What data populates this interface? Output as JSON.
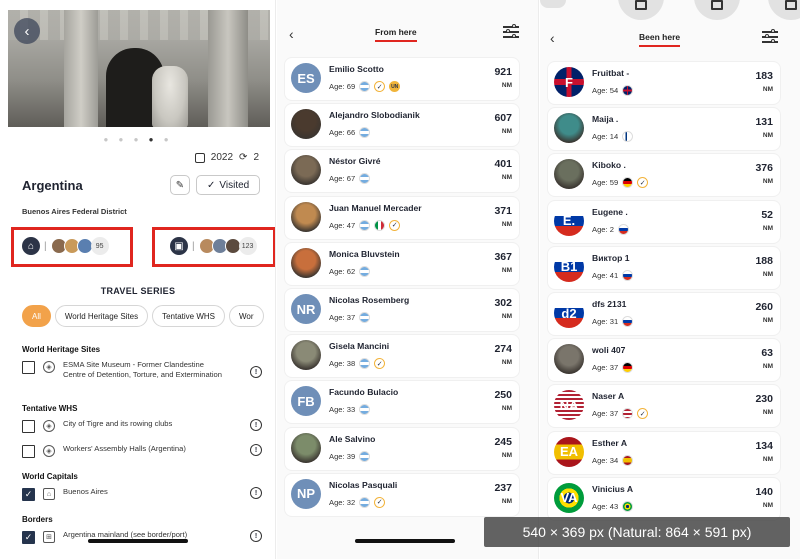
{
  "left": {
    "country": "Argentina",
    "region": "Buenos Aires Federal District",
    "year": "2022",
    "visits": "2",
    "visited_label": "Visited",
    "home_count": "95",
    "work_count": "123",
    "travel_series_title": "TRAVEL SERIES",
    "pills": [
      "All",
      "World Heritage Sites",
      "Tentative WHS",
      "Wor"
    ],
    "sections": [
      {
        "title": "World Heritage Sites",
        "items": [
          {
            "name": "ESMA Site Museum - Former Clandestine Centre of Detention, Torture, and Extermination",
            "checked": false
          }
        ]
      },
      {
        "title": "Tentative WHS",
        "items": [
          {
            "name": "City of Tigre and its rowing clubs",
            "checked": false
          },
          {
            "name": "Workers' Assembly Halls (Argentina)",
            "checked": false
          }
        ]
      },
      {
        "title": "World Capitals",
        "items": [
          {
            "name": "Buenos Aires",
            "checked": true
          }
        ]
      },
      {
        "title": "Borders",
        "items": [
          {
            "name": "Argentina mainland (see border/port)",
            "checked": true
          }
        ]
      }
    ]
  },
  "mid": {
    "tab": "From here",
    "rows": [
      {
        "name": "Emilio Scotto",
        "age": "Age: 69",
        "nm": "921",
        "initials": "ES",
        "color": "#6f8fb8",
        "badges": [
          "check",
          "un"
        ]
      },
      {
        "name": "Alejandro Slobodianik",
        "age": "Age: 66",
        "nm": "607",
        "initials": "",
        "color": "#4a3a2e",
        "badges": []
      },
      {
        "name": "Néstor Givré",
        "age": "Age: 67",
        "nm": "401",
        "initials": "",
        "color": "#7b6a55",
        "badges": []
      },
      {
        "name": "Juan Manuel Mercader",
        "age": "Age: 47",
        "nm": "371",
        "initials": "",
        "color": "#c08a50",
        "badges": [
          "italy",
          "check"
        ]
      },
      {
        "name": "Monica Bluvstein",
        "age": "Age: 62",
        "nm": "367",
        "initials": "",
        "color": "#c86f3c",
        "badges": []
      },
      {
        "name": "Nicolas Rosemberg",
        "age": "Age: 37",
        "nm": "302",
        "initials": "NR",
        "color": "#6f8fb8",
        "badges": []
      },
      {
        "name": "Gisela Mancini",
        "age": "Age: 38",
        "nm": "274",
        "initials": "",
        "color": "#8a8a76",
        "badges": [
          "check"
        ]
      },
      {
        "name": "Facundo Bulacio",
        "age": "Age: 33",
        "nm": "250",
        "initials": "FB",
        "color": "#6f8fb8",
        "badges": []
      },
      {
        "name": "Ale Salvino",
        "age": "Age: 39",
        "nm": "245",
        "initials": "",
        "color": "#7c8c6a",
        "badges": []
      },
      {
        "name": "Nicolas Pasquali",
        "age": "Age: 32",
        "nm": "237",
        "initials": "NP",
        "color": "#6f8fb8",
        "badges": [
          "check"
        ]
      }
    ],
    "unit": "NM"
  },
  "right": {
    "tab": "Been here",
    "rows": [
      {
        "name": "Fruitbat -",
        "age": "Age: 54",
        "nm": "183",
        "initials": "F",
        "color": "#c8102e",
        "flag": "uk",
        "badges": []
      },
      {
        "name": "Maija .",
        "age": "Age: 14",
        "nm": "131",
        "initials": "",
        "color": "#3f8c8a",
        "flag": "fi",
        "badges": []
      },
      {
        "name": "Kiboko .",
        "age": "Age: 59",
        "nm": "376",
        "initials": "",
        "color": "#6a6f5e",
        "flag": "de",
        "badges": [
          "check"
        ]
      },
      {
        "name": "Eugene .",
        "age": "Age: 2",
        "nm": "52",
        "initials": "E.",
        "color": "#2f4ea8",
        "flag": "ru",
        "badges": []
      },
      {
        "name": "Виктор 1",
        "age": "Age: 41",
        "nm": "188",
        "initials": "B1",
        "color": "#2f4ea8",
        "flag": "ru",
        "badges": []
      },
      {
        "name": "dfs 2131",
        "age": "Age: 31",
        "nm": "260",
        "initials": "d2",
        "color": "#2f4ea8",
        "flag": "ru",
        "badges": []
      },
      {
        "name": "woli 407",
        "age": "Age: 37",
        "nm": "63",
        "initials": "",
        "color": "#7a756b",
        "flag": "de",
        "badges": []
      },
      {
        "name": "Naser A",
        "age": "Age: 37",
        "nm": "230",
        "initials": "NA",
        "color": "#b22234",
        "flag": "us",
        "badges": [
          "check"
        ]
      },
      {
        "name": "Esther A",
        "age": "Age: 34",
        "nm": "134",
        "initials": "EA",
        "color": "#c8102e",
        "flag": "es",
        "badges": []
      },
      {
        "name": "Vinicius A",
        "age": "Age: 43",
        "nm": "140",
        "initials": "VA",
        "color": "#2a9d48",
        "flag": "br",
        "badges": []
      }
    ],
    "unit": "NM"
  },
  "overlay_text": "540 × 369 px (Natural: 864 × 591 px)",
  "colors": {
    "accent": "#e0261f",
    "orange": "#f2a24a",
    "navy": "#2c3447"
  }
}
